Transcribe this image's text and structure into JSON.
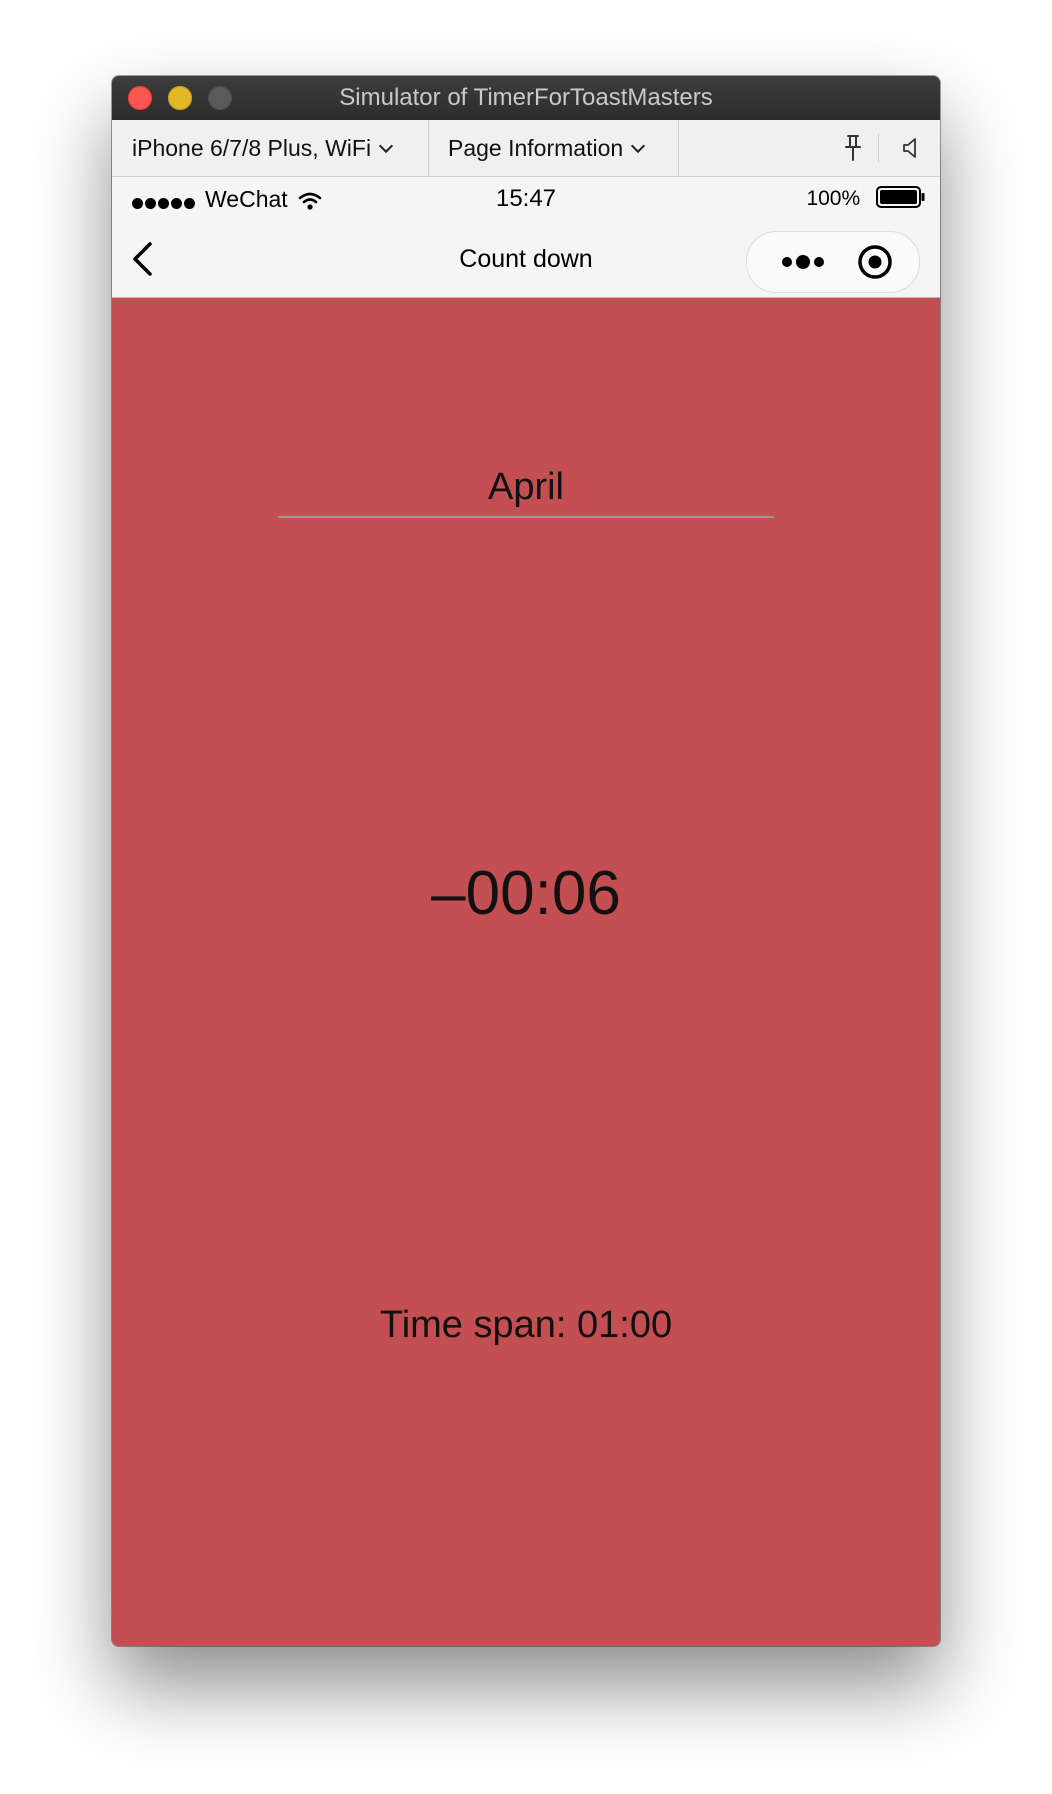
{
  "window": {
    "title": "Simulator of TimerForToastMasters"
  },
  "toolbar": {
    "device_label": "iPhone 6/7/8 Plus, WiFi",
    "page_label": "Page Information",
    "pin_icon": "pin-icon",
    "sound_icon": "speaker-icon"
  },
  "status_bar": {
    "carrier": "WeChat",
    "time": "15:47",
    "battery": "100%"
  },
  "nav": {
    "title": "Count down",
    "back_icon": "chevron-left-icon",
    "more_icon": "more-dots-icon",
    "close_icon": "record-target-icon"
  },
  "main": {
    "speaker_name": "April",
    "countdown": "–00:06",
    "time_span": "Time span: 01:00",
    "background_color": "#c44f52"
  }
}
